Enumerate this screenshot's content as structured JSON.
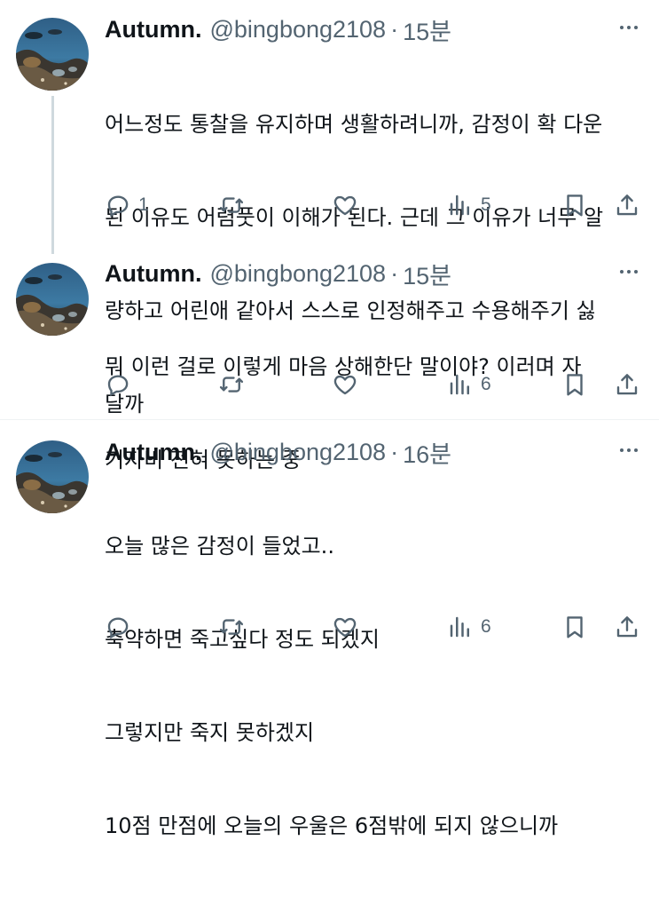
{
  "tweets": [
    {
      "name": "Autumn.",
      "handle": "@bingbong2108",
      "separator": "·",
      "time": "15분",
      "lines": [
        "어느정도 통찰을 유지하며 생활하려니까, 감정이 확 다운",
        "된 이유도 어렴풋이 이해가 된다. 근데 그 이유가 너무 알",
        "량하고 어린애 같아서 스스로 인정해주고 수용해주기 싫",
        "달까"
      ],
      "replies": "1",
      "retweets": "",
      "likes": "",
      "views": "5"
    },
    {
      "name": "Autumn.",
      "handle": "@bingbong2108",
      "separator": "·",
      "time": "15분",
      "lines": [
        "뭐 이런 걸로 이렇게 마음 상해한단 말이야? 이러며 자",
        "기자비 전혀 못하는 중"
      ],
      "replies": "",
      "retweets": "",
      "likes": "",
      "views": "6"
    },
    {
      "name": "Autumn.",
      "handle": "@bingbong2108",
      "separator": "·",
      "time": "16분",
      "lines": [
        "오늘 많은 감정이 들었고..",
        "축약하면 죽고싶다 정도 되겠지",
        "그렇지만 죽지 못하겠지",
        "10점 만점에 오늘의 우울은 6점밖에 되지 않으니까"
      ],
      "replies": "",
      "retweets": "",
      "likes": "",
      "views": "6"
    }
  ],
  "colors": {
    "text": "#0f1419",
    "muted": "#536471",
    "thread_line": "#cfd9de",
    "divider": "#eff3f4"
  },
  "icons": [
    "reply-icon",
    "retweet-icon",
    "like-icon",
    "views-icon",
    "bookmark-icon",
    "share-icon",
    "more-icon"
  ]
}
